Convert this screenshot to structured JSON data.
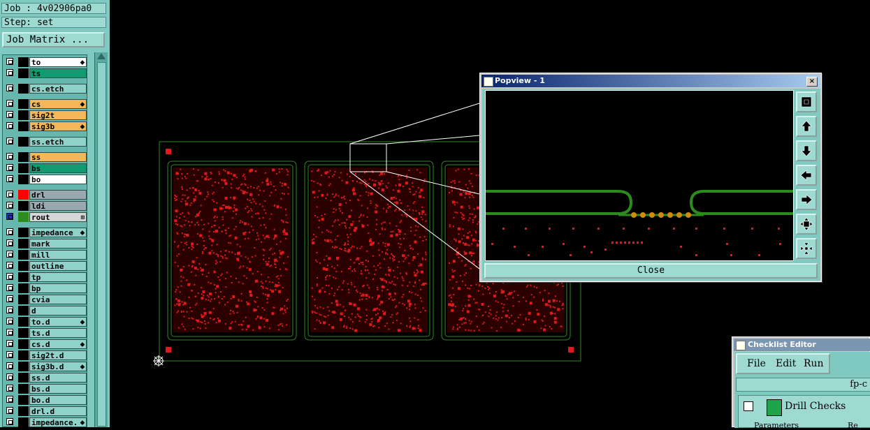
{
  "panel": {
    "job_label": "Job : 4v02906pa0",
    "step_label": "Step: set",
    "matrix_button": "Job Matrix ..."
  },
  "layers": [
    {
      "name": "to",
      "color": "#ffffff",
      "swatch": "#000000",
      "flag": "⬥"
    },
    {
      "name": "ts",
      "color": "#129b70",
      "swatch": "#000000",
      "flag": ""
    },
    {
      "name": "cs.etch",
      "color": "#8fd2ca",
      "swatch": "#000000",
      "flag": ""
    },
    {
      "name": "cs",
      "color": "#f6b75a",
      "swatch": "#000000",
      "flag": "⬥"
    },
    {
      "name": "sig2t",
      "color": "#f6b75a",
      "swatch": "#000000",
      "flag": ""
    },
    {
      "name": "sig3b",
      "color": "#f6b75a",
      "swatch": "#000000",
      "flag": "⬥"
    },
    {
      "name": "ss.etch",
      "color": "#8fd2ca",
      "swatch": "#000000",
      "flag": ""
    },
    {
      "name": "ss",
      "color": "#f6b75a",
      "swatch": "#000000",
      "flag": ""
    },
    {
      "name": "bs",
      "color": "#129b70",
      "swatch": "#000000",
      "flag": ""
    },
    {
      "name": "bo",
      "color": "#ffffff",
      "swatch": "#000000",
      "flag": ""
    },
    {
      "name": "drl",
      "color": "#9aa8b0",
      "swatch": "#ff0000",
      "flag": ""
    },
    {
      "name": "ldi",
      "color": "#9aa8b0",
      "swatch": "#000000",
      "flag": ""
    },
    {
      "name": "rout",
      "color": "#d6d6d6",
      "swatch": "#2d8a1e",
      "flag": "⊞"
    },
    {
      "name": "impedance",
      "color": "#8fd2ca",
      "swatch": "#000000",
      "flag": "⬥"
    },
    {
      "name": "mark",
      "color": "#8fd2ca",
      "swatch": "#000000",
      "flag": ""
    },
    {
      "name": "mill",
      "color": "#8fd2ca",
      "swatch": "#000000",
      "flag": ""
    },
    {
      "name": "outline",
      "color": "#8fd2ca",
      "swatch": "#000000",
      "flag": ""
    },
    {
      "name": "tp",
      "color": "#8fd2ca",
      "swatch": "#000000",
      "flag": ""
    },
    {
      "name": "bp",
      "color": "#8fd2ca",
      "swatch": "#000000",
      "flag": ""
    },
    {
      "name": "cvia",
      "color": "#8fd2ca",
      "swatch": "#000000",
      "flag": ""
    },
    {
      "name": "d",
      "color": "#8fd2ca",
      "swatch": "#000000",
      "flag": ""
    },
    {
      "name": "to.d",
      "color": "#8fd2ca",
      "swatch": "#000000",
      "flag": "⬥"
    },
    {
      "name": "ts.d",
      "color": "#8fd2ca",
      "swatch": "#000000",
      "flag": ""
    },
    {
      "name": "cs.d",
      "color": "#8fd2ca",
      "swatch": "#000000",
      "flag": "⬥"
    },
    {
      "name": "sig2t.d",
      "color": "#8fd2ca",
      "swatch": "#000000",
      "flag": ""
    },
    {
      "name": "sig3b.d",
      "color": "#8fd2ca",
      "swatch": "#000000",
      "flag": "⬥"
    },
    {
      "name": "ss.d",
      "color": "#8fd2ca",
      "swatch": "#000000",
      "flag": ""
    },
    {
      "name": "bs.d",
      "color": "#8fd2ca",
      "swatch": "#000000",
      "flag": ""
    },
    {
      "name": "bo.d",
      "color": "#8fd2ca",
      "swatch": "#000000",
      "flag": ""
    },
    {
      "name": "drl.d",
      "color": "#8fd2ca",
      "swatch": "#000000",
      "flag": ""
    },
    {
      "name": "impedance.",
      "color": "#8fd2ca",
      "swatch": "#000000",
      "flag": "⬥"
    }
  ],
  "popview": {
    "title": "Popview - 1",
    "close_x": "×",
    "close_button": "Close",
    "tools": [
      "zoom-fit-icon",
      "pan-up-icon",
      "pan-down-icon",
      "pan-left-icon",
      "pan-right-icon",
      "zoom-in-icon",
      "zoom-out-icon"
    ]
  },
  "checklist": {
    "title": "Checklist Editor",
    "menu": {
      "file": "File",
      "edit": "Edit",
      "run": "Run"
    },
    "path": "fp-c",
    "item_label": "Drill Checks",
    "tab_parameters": "Parameters",
    "tab_re": "Re"
  },
  "colors": {
    "board_outline": "#2d8a1e",
    "copper_pads": "#e01a1a",
    "panel_bg": "#7fc9c1"
  }
}
